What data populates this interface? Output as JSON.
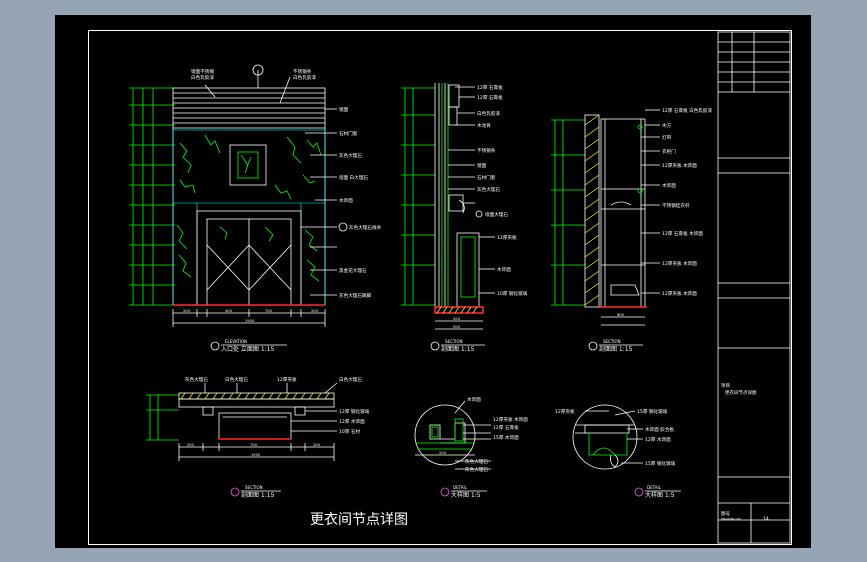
{
  "drawing": {
    "main_title": "更衣间节点详图",
    "views": {
      "elevation": {
        "tag": "ELEVATION",
        "title": "入口处 立面图 1:15"
      },
      "section_a": {
        "tag": "SECTION",
        "title": "剖面图 1:15"
      },
      "section_b": {
        "tag": "SECTION",
        "title": "剖面图 1:15"
      },
      "section_c": {
        "tag": "SECTION",
        "title": "剖面图 1:15"
      },
      "detail_a": {
        "tag": "DETAIL",
        "title": "大样图 1:5"
      },
      "detail_b": {
        "tag": "DETAIL",
        "title": "大样图 1:5"
      }
    },
    "labels": {
      "elev_l1": "镜面不锈钢",
      "elev_l2": "白色乳胶漆",
      "elev_l3": "不锈钢条",
      "elev_l4": "白色乳胶漆",
      "elev_l5": "镜面",
      "elev_l6": "石材门套",
      "elev_l7": "灰色大理石",
      "elev_l8": "墙面 白大理石",
      "elev_l9": "木饰面",
      "elev_l10": "灰色大理石线条",
      "elev_l11": "黑金花大理石",
      "elev_l12": "灰色大理石踢脚",
      "sa_1": "12厚 石膏板",
      "sa_2": "12厚 石膏板",
      "sa_3": "白色乳胶漆",
      "sa_4": "木龙骨",
      "sa_5": "不锈钢条",
      "sa_6": "镜面",
      "sa_7": "石材门套",
      "sa_8": "灰色大理石",
      "sa_9": "墙面大理石",
      "sa_10": "12厚夹板",
      "sa_11": "木饰面",
      "sa_12": "10厚 钢化玻璃",
      "sb_1": "12厚 石膏板 白色乳胶漆",
      "sb_2": "木方",
      "sb_3": "灯带",
      "sb_4": "衣柜门",
      "sb_5": "12厚夹板 木饰面",
      "sb_6": "木饰面",
      "sb_7": "不锈钢挂衣杆",
      "sb_8": "12厚 石膏板 木饰面",
      "sb_9": "12厚夹板 木饰面",
      "sb_10": "12厚夹板 木饰面",
      "sc_1": "灰色大理石",
      "sc_2": "白色大理石",
      "sc_3": "12厚夹板",
      "sc_4": "白色大理石",
      "sc_5": "12厚 钢化玻璃",
      "sc_6": "12厚 木饰面",
      "sc_7": "10厚 石材",
      "da_1": "木饰面",
      "da_2": "12厚夹板 木饰面",
      "da_3": "12厚 石膏板",
      "da_4": "15厚 木饰面",
      "da_5": "灰色大理石",
      "da_6": "灰色大理石",
      "db_1": "12厚夹板",
      "db_2": "15厚 钢化玻璃",
      "db_3": "木饰面 胶合板",
      "db_4": "12厚 木饰面",
      "db_5": "15厚 钢化玻璃"
    },
    "dims": {
      "elev_total": "1900",
      "elev_a": "200",
      "elev_b": "400",
      "elev_c": "700",
      "elev_d": "200",
      "elev_e": "200",
      "sa_total": "500",
      "sa_a": "200",
      "sb_total": "600",
      "sc_total": "1900",
      "sc_a": "200",
      "sc_b": "700",
      "sc_c": "200",
      "da_a": "200"
    }
  },
  "title_block": {
    "project_label": "项目",
    "drawing_name": "更衣间节点详图",
    "sheet_label": "图号",
    "sheet_sub": "DRAWING NO.",
    "sheet_no": "14"
  },
  "colors": {
    "background": "#96a5b6",
    "sheet": "#000000",
    "line_green": "#00ff00",
    "line_white": "#ffffff",
    "line_cyan": "#00ffff",
    "line_red": "#ff2a2a"
  }
}
